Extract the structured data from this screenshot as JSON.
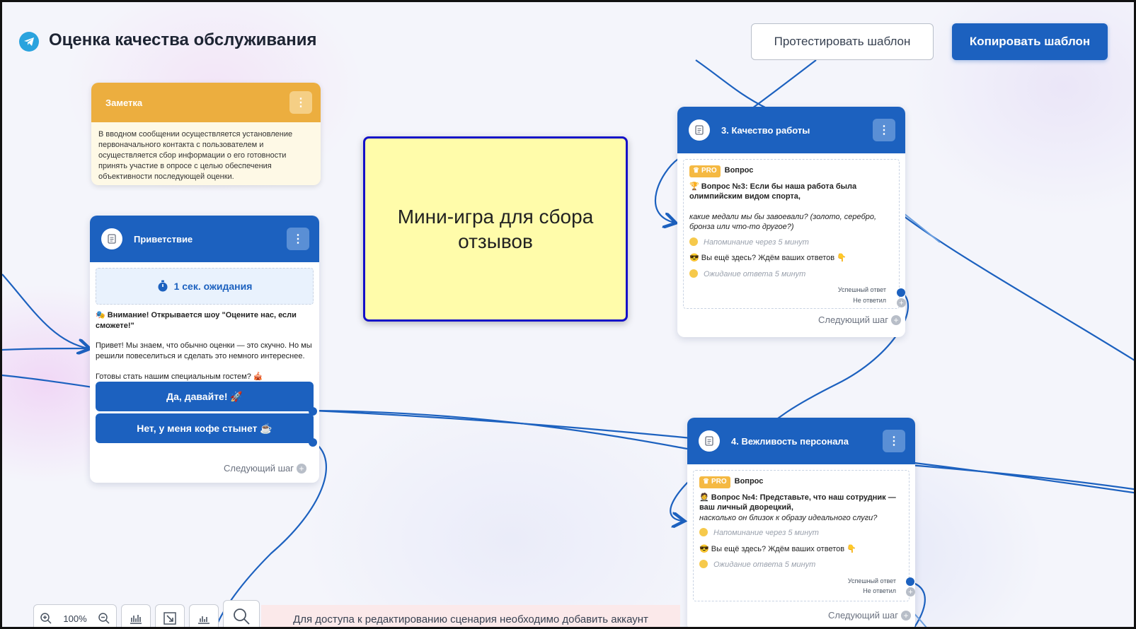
{
  "header": {
    "title": "Оценка качества обслуживания",
    "test_button": "Протестировать шаблон",
    "copy_button": "Копировать шаблон"
  },
  "note": {
    "title": "Заметка",
    "text": "В вводном сообщении осуществляется установление первоначального контакта с пользователем и осуществляется сбор информации о его готовности принять участие в опросе с целью обеспечения объективности последующей оценки."
  },
  "sticky": {
    "text": "Мини-игра для сбора отзывов"
  },
  "greeting": {
    "title": "Приветствие",
    "wait_label": "1 сек. ожидания",
    "attention": "🎭 Внимание! Открывается шоу \"Оцените нас, если сможете!\"",
    "intro": "Привет! Мы знаем, что обычно оценки — это скучно. Но мы решили повеселиться и сделать это немного интереснее.",
    "invite": "Готовы стать нашим специальным гостем? 🎪",
    "buttons": [
      "Да, давайте! 🚀",
      "Нет, у меня кофе стынет ☕"
    ],
    "next_step": "Следующий шаг"
  },
  "step3": {
    "title": "3. Качество работы",
    "pro": "PRO",
    "type": "Вопрос",
    "question_bold": "🏆 Вопрос №3: Если бы наша работа была олимпийским видом спорта,",
    "question_italic": "какие медали мы бы завоевали? (золото, серебро, бронза или что-то другое?)",
    "reminder": "Напоминание через 5 минут",
    "still_here": "😎 Вы ещё здесь? Ждём ваших ответов 👇",
    "waiting": "Ожидание ответа 5 минут",
    "success": "Успешный ответ",
    "no_answer": "Не ответил",
    "next_step": "Следующий шаг"
  },
  "step4": {
    "title": "4. Вежливость персонала",
    "pro": "PRO",
    "type": "Вопрос",
    "question_bold": "🤵 Вопрос №4: Представьте, что наш сотрудник — ваш личный дворецкий,",
    "question_italic": "насколько он близок к образу идеального слуги?",
    "reminder": "Напоминание через 5 минут",
    "still_here": "😎 Вы ещё здесь? Ждём ваших ответов 👇",
    "waiting": "Ожидание ответа 5 минут",
    "success": "Успешный ответ",
    "no_answer": "Не ответил",
    "next_step": "Следующий шаг"
  },
  "toolbar": {
    "zoom": "100%"
  },
  "banner": {
    "text": "Для доступа к редактированию сценария необходимо добавить аккаунт"
  },
  "colors": {
    "primary": "#1c61bf",
    "note": "#ecae3f",
    "sticky": "#fffcaa",
    "sticky_border": "#1410c8",
    "pro": "#f5b942",
    "banner": "#fbe9ea"
  }
}
